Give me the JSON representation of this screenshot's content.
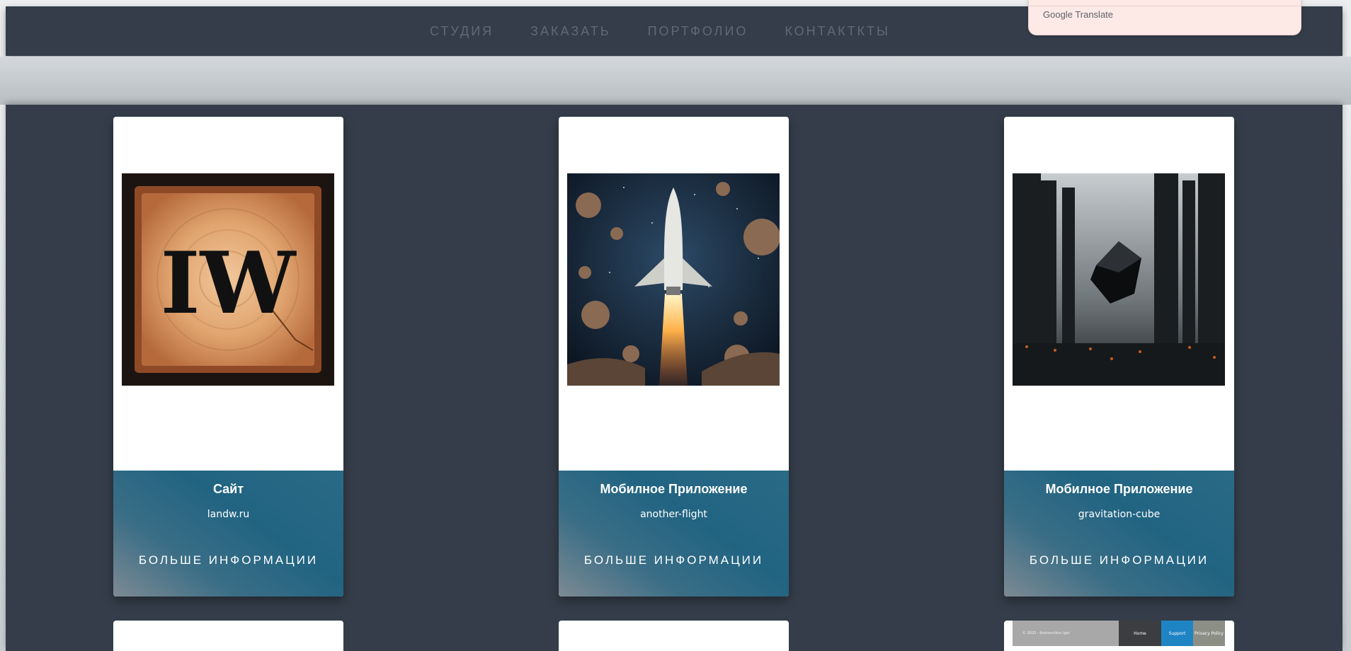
{
  "nav": {
    "items": [
      "СТУДИЯ",
      "ЗАКАЗАТЬ",
      "ПОРТФОЛИО",
      "КОНТАКТКТЫ"
    ]
  },
  "translate": {
    "brand": "Google",
    "product": "Translate"
  },
  "cards": [
    {
      "title": "Сайт",
      "subtitle": "landw.ru",
      "more": "БОЛЬШЕ ИНФОРМАЦИИ",
      "image": "lw-wood-logo"
    },
    {
      "title": "Мобилное Приложение",
      "subtitle": "another-flight",
      "more": "БОЛЬШЕ ИНФОРМАЦИИ",
      "image": "rocket-asteroids"
    },
    {
      "title": "Мобилное Приложение",
      "subtitle": "gravitation-cube",
      "more": "БОЛЬШЕ ИНФОРМАЦИИ",
      "image": "floating-cube"
    }
  ],
  "peek_footer": {
    "copyright": "© 2025 - Kozhevnikov Igor",
    "home": "Home",
    "support": "Support",
    "privacy": "Privacy Policy"
  },
  "colors": {
    "navbar": "#343d49",
    "nav_text": "#5f6a77",
    "footer_gradient_main": "#216482",
    "translate_bg": "#fde9e6"
  }
}
